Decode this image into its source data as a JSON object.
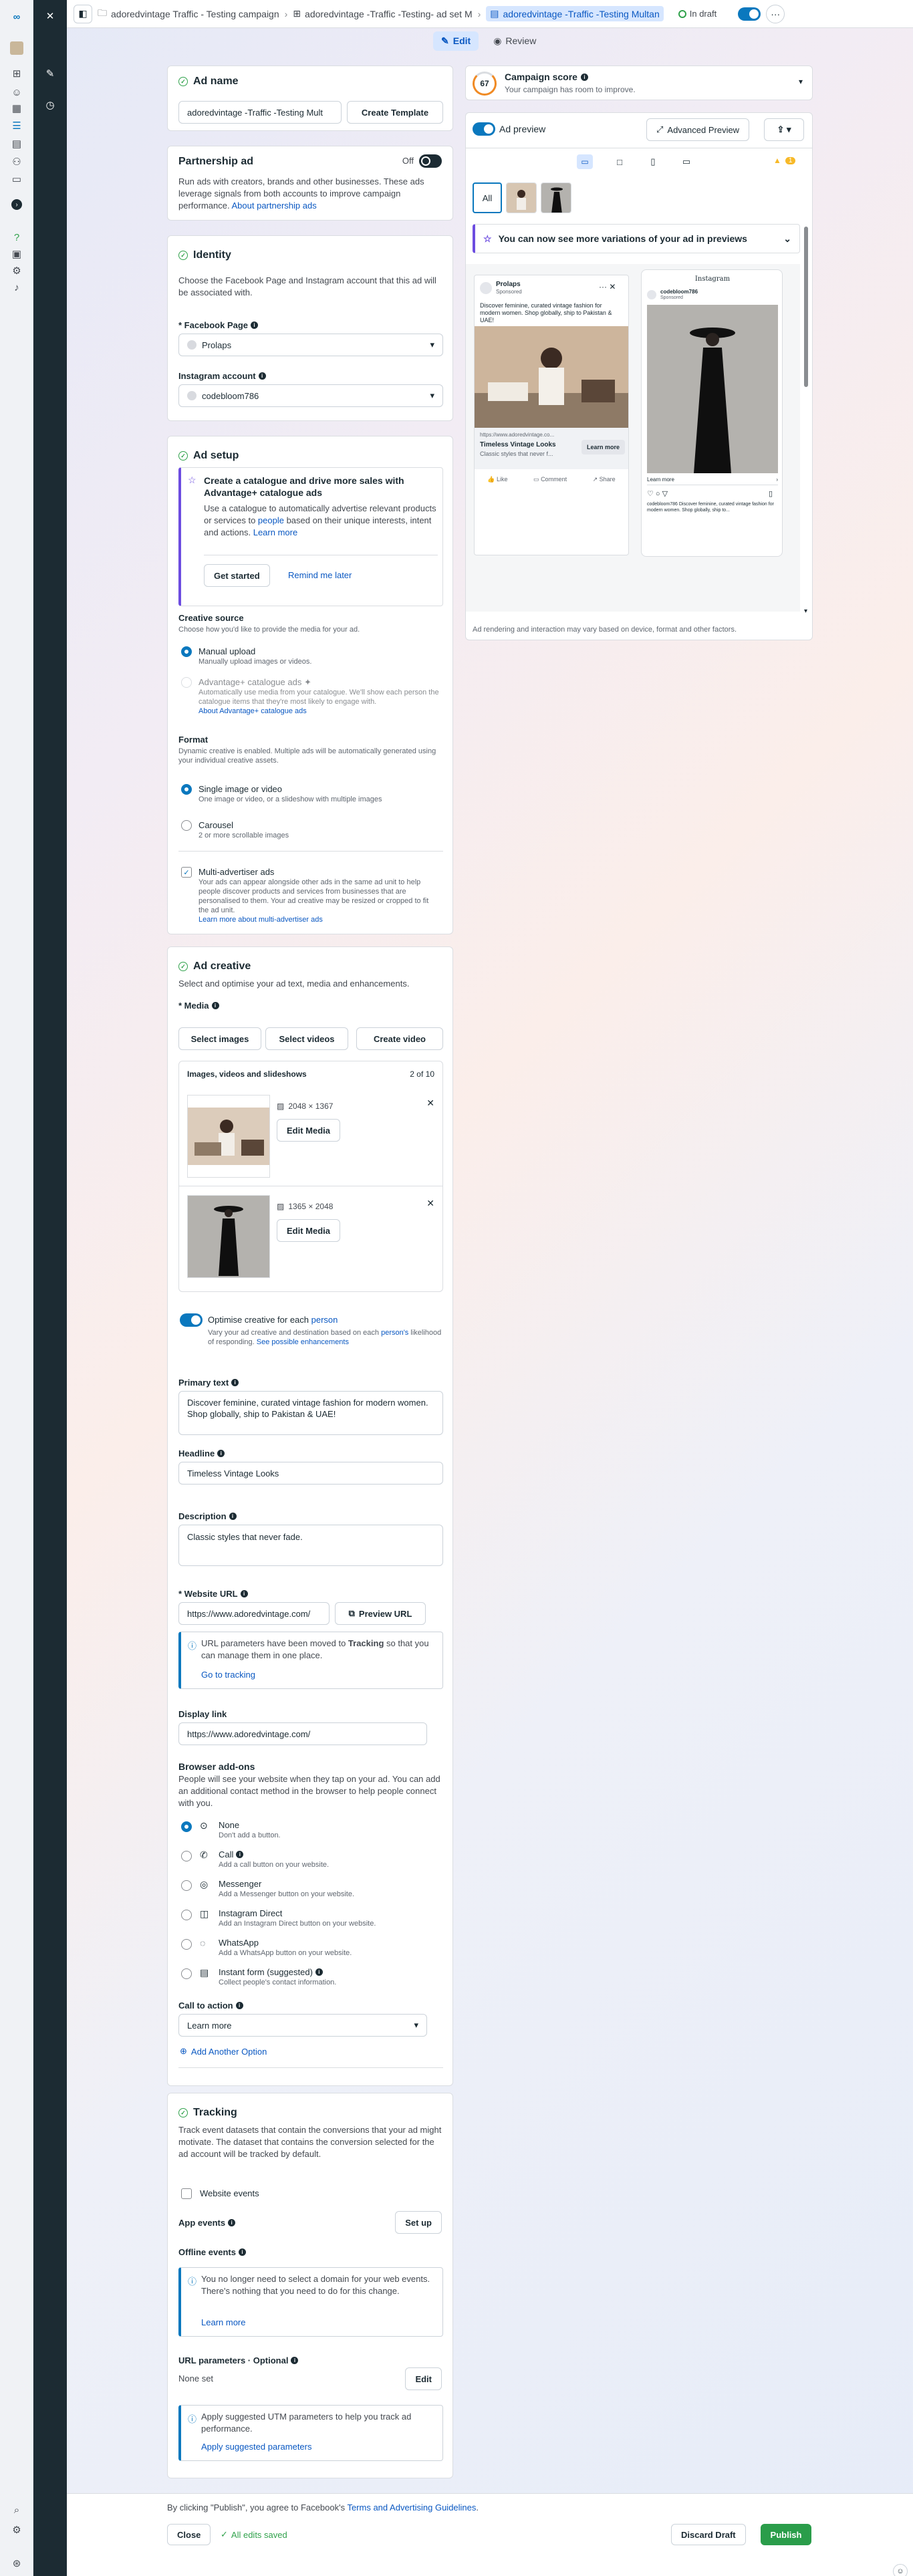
{
  "colors": {
    "brand": "#0a78be",
    "rail_dark": "#1c2b33",
    "publish": "#2a9d4a",
    "active_tab": "#d6e6ff",
    "warning": "#f7b928"
  },
  "rail": {
    "icons": [
      "meta-logo-icon",
      "close-icon",
      "picture-icon",
      "pencil-icon",
      "clock-icon",
      "smiley-icon",
      "grid-icon",
      "table-icon",
      "document-icon",
      "people-icon",
      "card-icon",
      "chevron-right-icon",
      "help-icon",
      "page-icon",
      "gear-icon",
      "bell-icon",
      "search-icon",
      "settings-icon",
      "bug-icon"
    ]
  },
  "topbar": {
    "crumbs": [
      "adoredvintage Traffic - Testing campaign",
      "adoredvintage -Traffic -Testing- ad set M",
      "adoredvintage -Traffic -Testing Multan"
    ],
    "status": "In draft"
  },
  "tabs": {
    "edit": "Edit",
    "review": "Review"
  },
  "ad_name": {
    "title": "Ad name",
    "value": "adoredvintage -Traffic -Testing Mult",
    "create_template": "Create Template"
  },
  "partnership": {
    "title": "Partnership ad",
    "toggle_label": "Off",
    "desc": "Run ads with creators, brands and other businesses. These ads leverage signals from both accounts to improve campaign performance.",
    "link": "About partnership ads"
  },
  "identity": {
    "title": "Identity",
    "desc": "Choose the Facebook Page and Instagram account that this ad will be associated with.",
    "fb_label": "* Facebook Page",
    "fb_value": "Prolaps",
    "ig_label": "Instagram account",
    "ig_value": "codebloom786"
  },
  "ad_setup": {
    "title": "Ad setup",
    "catalog_title": "Create a catalogue and drive more sales with Advantage+ catalogue ads",
    "catalog_desc_a": "Use a catalogue to automatically advertise relevant products or services to ",
    "catalog_desc_link": "people",
    "catalog_desc_b": " based on their unique interests, intent and actions. ",
    "catalog_learn": "Learn more",
    "get_started": "Get started",
    "remind": "Remind me later",
    "source_title": "Creative source",
    "source_desc": "Choose how you'd like to provide the media for your ad.",
    "manual_title": "Manual upload",
    "manual_desc": "Manually upload images or videos.",
    "adv_title": "Advantage+ catalogue ads",
    "adv_desc": "Automatically use media from your catalogue. We'll show each person the catalogue items that they're most likely to engage with.",
    "adv_link": "About Advantage+ catalogue ads",
    "format_title": "Format",
    "format_desc": "Dynamic creative is enabled. Multiple ads will be automatically generated using your individual creative assets.",
    "single_title": "Single image or video",
    "single_desc": "One image or video, or a slideshow with multiple images",
    "carousel_title": "Carousel",
    "carousel_desc": "2 or more scrollable images",
    "multi_title": "Multi-advertiser ads",
    "multi_desc": "Your ads can appear alongside other ads in the same ad unit to help people discover products and services from businesses that are personalised to them. Your ad creative may be resized or cropped to fit the ad unit.",
    "multi_link": "Learn more about multi-advertiser ads"
  },
  "creative": {
    "title": "Ad creative",
    "desc": "Select and optimise your ad text, media and enhancements.",
    "media_label": "* Media",
    "select_images": "Select images",
    "select_videos": "Select videos",
    "create_video": "Create video",
    "list_title": "Images, videos and slideshows",
    "list_count": "2 of 10",
    "items": [
      {
        "dims": "2048 × 1367",
        "edit": "Edit Media"
      },
      {
        "dims": "1365 × 2048",
        "edit": "Edit Media"
      }
    ],
    "optimise_a": "Optimise creative for each ",
    "optimise_link": "person",
    "optimise_desc_a": "Vary your ad creative and destination based on each ",
    "optimise_desc_link": "person's",
    "optimise_desc_b": " likelihood of responding. ",
    "optimise_see": "See possible enhancements",
    "primary_label": "Primary text",
    "primary_value": "Discover feminine, curated vintage fashion for modern women. Shop globally, ship to Pakistan & UAE!",
    "headline_label": "Headline",
    "headline_value": "Timeless Vintage Looks",
    "description_label": "Description",
    "description_value": "Classic styles that never fade.",
    "website_label": "* Website URL",
    "website_value": "https://www.adoredvintage.com/",
    "preview_url": "Preview URL",
    "url_notice_a": "URL parameters have been moved to ",
    "url_notice_bold": "Tracking",
    "url_notice_b": " so that you can manage them in one place.",
    "go_tracking": "Go to tracking",
    "display_label": "Display link",
    "display_value": "https://www.adoredvintage.com/",
    "addons_title": "Browser add-ons",
    "addons_desc": "People will see your website when they tap on your ad. You can add an additional contact method in the browser to help people connect with you.",
    "addons": [
      {
        "icon": "no-entry-icon",
        "title": "None",
        "desc": "Don't add a button.",
        "selected": true
      },
      {
        "icon": "phone-icon",
        "title": "Call",
        "desc": "Add a call button on your website.",
        "selected": false
      },
      {
        "icon": "messenger-icon",
        "title": "Messenger",
        "desc": "Add a Messenger button on your website.",
        "selected": false
      },
      {
        "icon": "instagram-icon",
        "title": "Instagram Direct",
        "desc": "Add an Instagram Direct button on your website.",
        "selected": false
      },
      {
        "icon": "whatsapp-icon",
        "title": "WhatsApp",
        "desc": "Add a WhatsApp button on your website.",
        "selected": false
      },
      {
        "icon": "form-icon",
        "title": "Instant form (suggested)",
        "desc": "Collect people's contact information.",
        "selected": false
      }
    ],
    "cta_label": "Call to action",
    "cta_value": "Learn more",
    "add_option": "Add Another Option"
  },
  "tracking": {
    "title": "Tracking",
    "desc": "Track event datasets that contain the conversions that your ad might motivate. The dataset that contains the conversion selected for the ad account will be tracked by default.",
    "website_events": "Website events",
    "app_events": "App events",
    "set_up": "Set up",
    "offline_events": "Offline events",
    "offline_notice": "You no longer need to select a domain for your web events. There's nothing that you need to do for this change.",
    "learn_more": "Learn more",
    "url_params_label": "URL parameters · Optional",
    "none_set": "None set",
    "edit": "Edit",
    "utm_notice": "Apply suggested UTM parameters to help you track ad performance.",
    "apply_params": "Apply suggested parameters"
  },
  "footer": {
    "terms_a": "By clicking \"Publish\", you agree to Facebook's ",
    "terms_link": "Terms and Advertising Guidelines",
    "terms_b": ".",
    "close": "Close",
    "saved": "All edits saved",
    "discard": "Discard Draft",
    "publish": "Publish"
  },
  "score": {
    "value": "67",
    "title": "Campaign score",
    "desc": "Your campaign has room to improve."
  },
  "preview": {
    "label": "Ad preview",
    "advanced": "Advanced Preview",
    "warning_count": "1",
    "all": "All",
    "banner": "You can now see more variations of your ad in previews",
    "fb": {
      "page": "Prolaps",
      "sponsored": "Sponsored",
      "text": "Discover feminine, curated vintage fashion for modern women. Shop globally, ship to Pakistan & UAE!",
      "url": "https://www.adoredvintage.co...",
      "headline": "Timeless Vintage Looks",
      "desc": "Classic styles that never f...",
      "cta": "Learn more",
      "like": "Like",
      "comment": "Comment",
      "share": "Share"
    },
    "ig": {
      "brand": "Instagram",
      "account": "codebloom786",
      "sponsored": "Sponsored",
      "cta": "Learn more",
      "caption": "codebloom786 Discover feminine, curated vintage fashion for modern women. Shop globally, ship to..."
    },
    "disclaimer": "Ad rendering and interaction may vary based on device, format and other factors."
  }
}
